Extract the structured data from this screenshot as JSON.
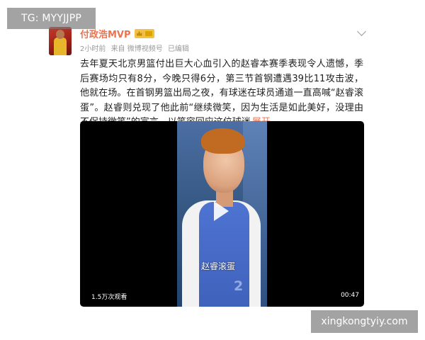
{
  "overlay": {
    "top_tag": "TG: MYYJJPP",
    "bottom_watermark": "xingkongtyiy.com"
  },
  "post": {
    "username": "付政浩MVP",
    "meta": {
      "time": "2小时前",
      "source": "来自 微博视频号",
      "edited": "已编辑"
    },
    "text": "去年夏天北京男篮付出巨大心血引入的赵睿本赛季表现令人遗憾，季后赛场均只有8分，今晚只得6分，第三节首钢遭遇39比11攻击波，他就在场。在首钢男篮出局之夜，有球迷在球员通道一直高喊“赵睿滚蛋”。赵睿则兑现了他此前“继续微笑，因为生活是如此美好，没理由不保持微笑”的宣言，以笑容回应这位球迷",
    "expand_label": "展开"
  },
  "video": {
    "subtitle": "赵睿滚蛋",
    "views": "1.5万次观看",
    "duration": "00:47"
  },
  "icons": {
    "avatar": "avatar-image",
    "badge": "vip-badge-icon",
    "menu": "chevron-down-icon",
    "play": "play-icon"
  }
}
